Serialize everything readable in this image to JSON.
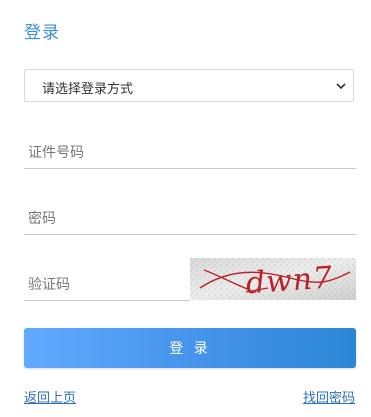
{
  "header": {
    "title": "登录"
  },
  "login_method": {
    "selected": "请选择登录方式"
  },
  "fields": {
    "id_number_placeholder": "证件号码",
    "password_placeholder": "密码",
    "captcha_placeholder": "验证码"
  },
  "captcha": {
    "text": "dwn7"
  },
  "actions": {
    "login_label": "登 录",
    "back_label": "返回上页",
    "recover_label": "找回密码"
  },
  "colors": {
    "title": "#3b8fd6",
    "button_start": "#62aaff",
    "button_end": "#2c86d6",
    "link": "#2d6fb8",
    "captcha_text": "#b8232a"
  }
}
